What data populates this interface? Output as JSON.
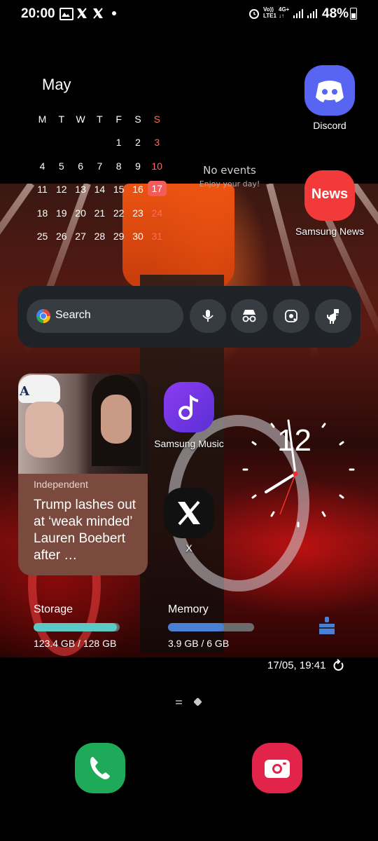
{
  "status_bar": {
    "time": "20:00",
    "notification_icons": [
      "gallery-icon",
      "x-icon",
      "x-icon",
      "dot-icon"
    ],
    "network_top": "Vo))",
    "network_bottom": "LTE1",
    "network2_top": "4G+",
    "battery": "48%"
  },
  "calendar": {
    "month": "May",
    "weekdays": [
      "M",
      "T",
      "W",
      "T",
      "F",
      "S",
      "S"
    ],
    "weeks": [
      [
        "",
        "",
        "",
        "",
        "1",
        "2",
        "3"
      ],
      [
        "4",
        "5",
        "6",
        "7",
        "8",
        "9",
        "10"
      ],
      [
        "11",
        "12",
        "13",
        "14",
        "15",
        "16",
        "17"
      ],
      [
        "18",
        "19",
        "20",
        "21",
        "22",
        "23",
        "24"
      ],
      [
        "25",
        "26",
        "27",
        "28",
        "29",
        "30",
        "31"
      ]
    ],
    "today": "17",
    "no_events": "No events",
    "enjoy": "Enjoy your day!"
  },
  "apps": {
    "discord": "Discord",
    "samsung_news": "Samsung News",
    "samsung_news_icon_text": "News",
    "samsung_music": "Samsung Music",
    "x": "X"
  },
  "search_widget": {
    "placeholder": "Search",
    "buttons": [
      "mic-icon",
      "incognito-icon",
      "lens-icon",
      "dino-icon"
    ]
  },
  "news_card": {
    "source": "Independent",
    "headline": "Trump lashes out at ‘weak minded’ Lauren Boebert after …"
  },
  "clock": {
    "hour_marker": "12"
  },
  "device_care": {
    "storage_label": "Storage",
    "storage_value": "123.4 GB / 128 GB",
    "storage_fraction": 0.964,
    "memory_label": "Memory",
    "memory_value": "3.9 GB / 6 GB",
    "memory_fraction": 0.65,
    "updated": "17/05, 19:41",
    "storage_color": "#5bc9c4",
    "memory_color": "#4a7fd6"
  },
  "dock": {
    "apps": [
      "phone-icon",
      "camera-icon"
    ]
  }
}
